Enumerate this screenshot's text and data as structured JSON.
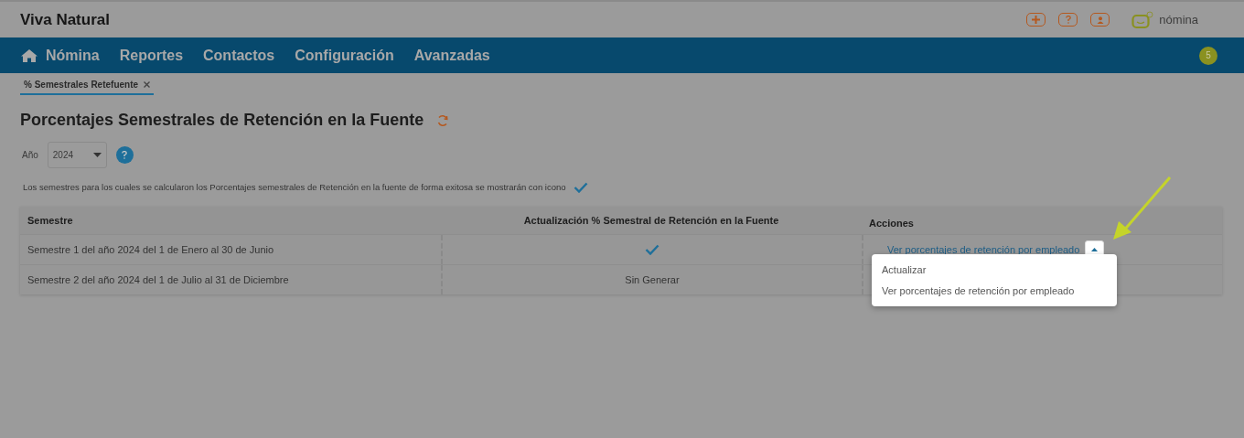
{
  "app": {
    "title": "Viva Natural",
    "brand": "nómina"
  },
  "nav": {
    "items": [
      "Nómina",
      "Reportes",
      "Contactos",
      "Configuración",
      "Avanzadas"
    ],
    "badge": "5"
  },
  "open_tabs": [
    {
      "label": "% Semestrales Retefuente",
      "selected": true
    }
  ],
  "page": {
    "title": "Porcentajes Semestrales de Retención en la Fuente",
    "year": {
      "label": "Año",
      "value": "2024"
    },
    "note": "Los semestres para los cuales se calcularon los Porcentajes semestrales de Retención en la fuente de forma exitosa se mostrarán con icono"
  },
  "table": {
    "columns": [
      "Semestre",
      "Actualización % Semestral de Retención en la Fuente",
      "Acciones"
    ],
    "rows": [
      {
        "semestre": "Semestre 1 del año 2024 del 1 de Enero al 30 de Junio",
        "status": {
          "kind": "check"
        },
        "action": "Ver porcentajes de retención por empleado",
        "expanded": true
      },
      {
        "semestre": "Semestre 2 del año 2024 del 1 de Julio al 31 de Diciembre",
        "status": {
          "kind": "text",
          "text": "Sin Generar"
        }
      }
    ]
  },
  "dropdown": {
    "items": [
      "Actualizar",
      "Ver porcentajes de retención por empleado"
    ]
  }
}
